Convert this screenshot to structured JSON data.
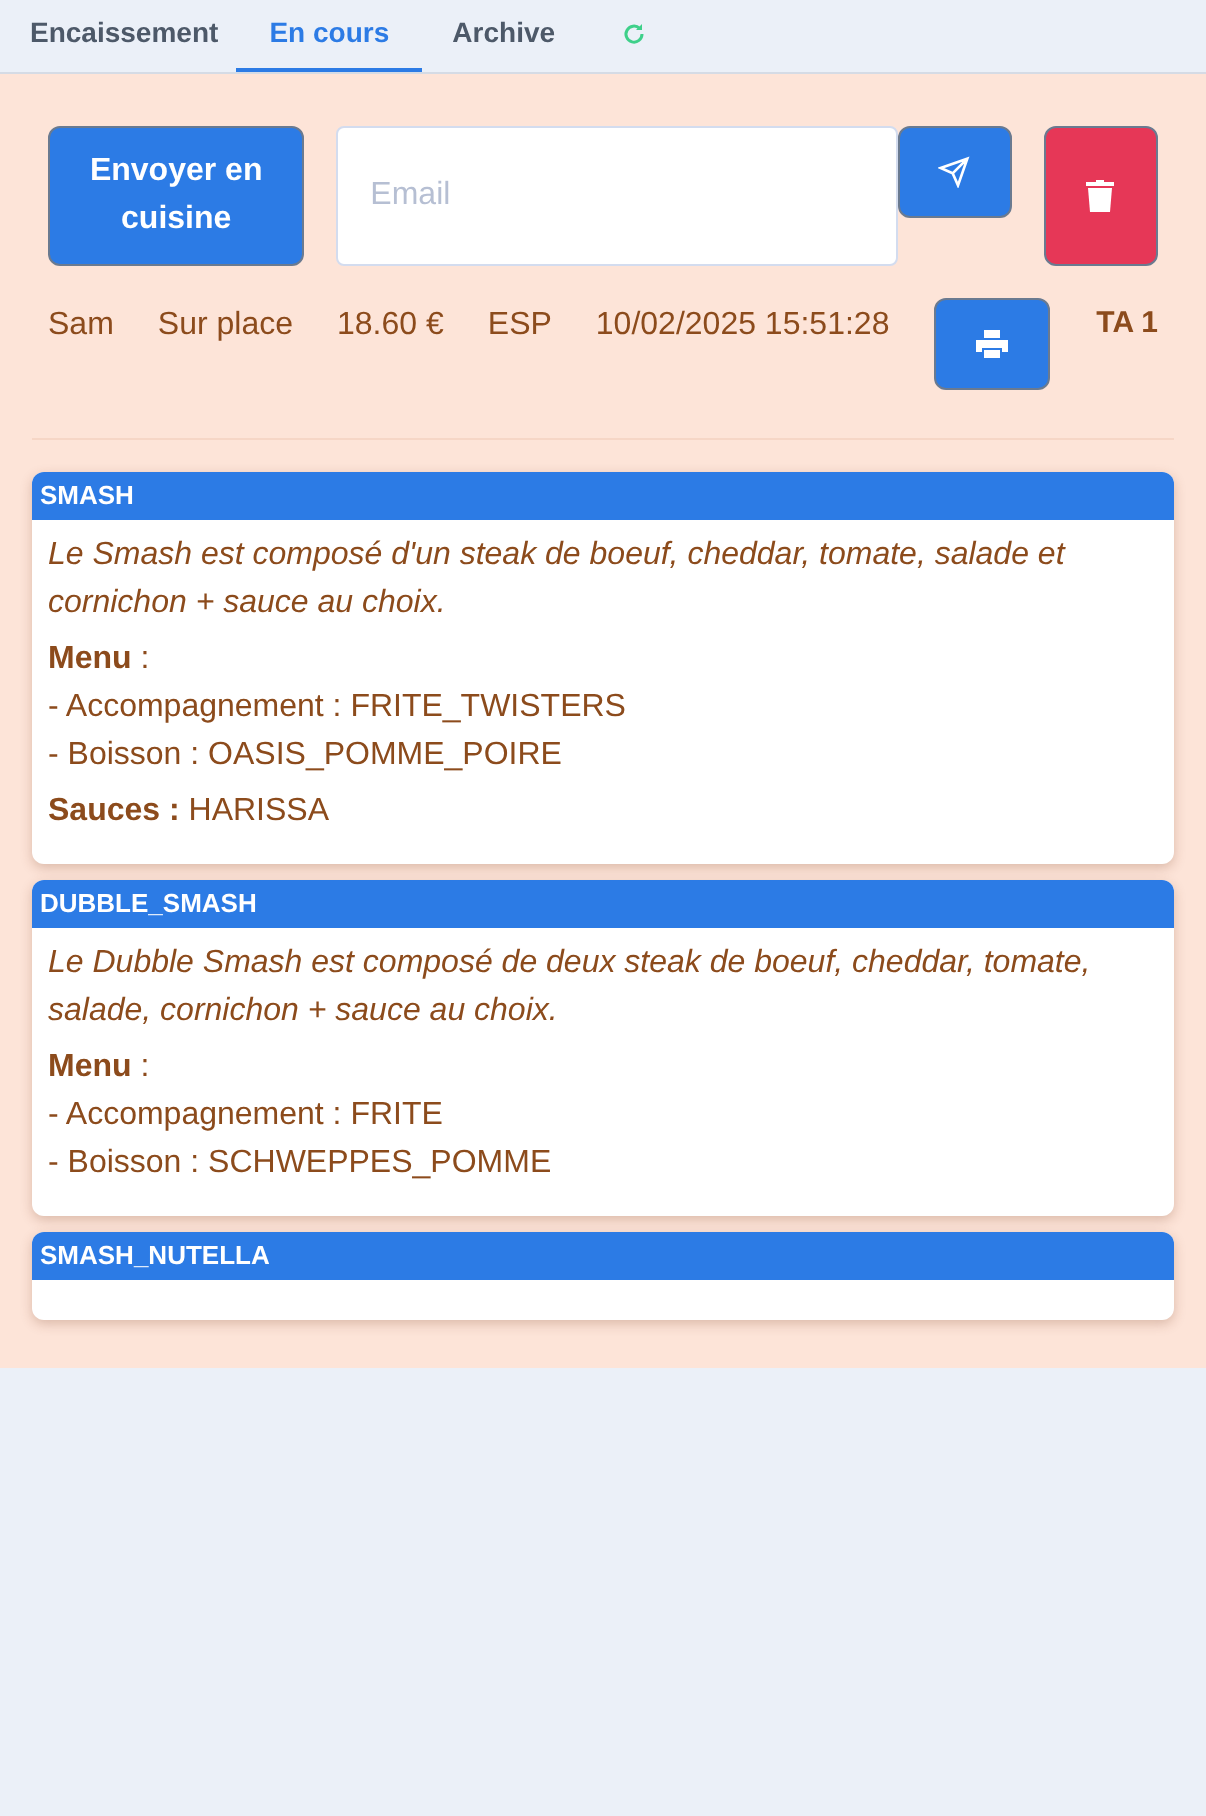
{
  "tabs": [
    {
      "label": "Encaissement",
      "selected": false
    },
    {
      "label": "En cours",
      "selected": true
    },
    {
      "label": "Archive",
      "selected": false
    }
  ],
  "order": {
    "send_kitchen_label": "Envoyer en cuisine",
    "email": {
      "placeholder": "Email"
    },
    "info": [
      "Sam",
      "Sur place",
      "18.60 €",
      "ESP",
      "10/02/2025 15:51:28"
    ],
    "table": "TA 1"
  },
  "items": [
    {
      "name": "SMASH",
      "description": "Le Smash est composé d'un steak de boeuf, cheddar, tomate, salade et cornichon + sauce au choix.",
      "lines": [
        "**Menu** :",
        "- Accompagnement : FRITE_TWISTERS",
        "- Boisson : OASIS_POMME_POIRE"
      ],
      "extra": "**Sauces :** HARISSA"
    },
    {
      "name": "DUBBLE_SMASH",
      "description": "Le Dubble Smash est composé de deux steak de boeuf, cheddar, tomate, salade, cornichon + sauce au choix.",
      "lines": [
        "**Menu** :",
        "- Accompagnement : FRITE",
        "- Boisson : SCHWEPPES_POMME"
      ]
    },
    {
      "name": "SMASH_NUTELLA"
    }
  ]
}
